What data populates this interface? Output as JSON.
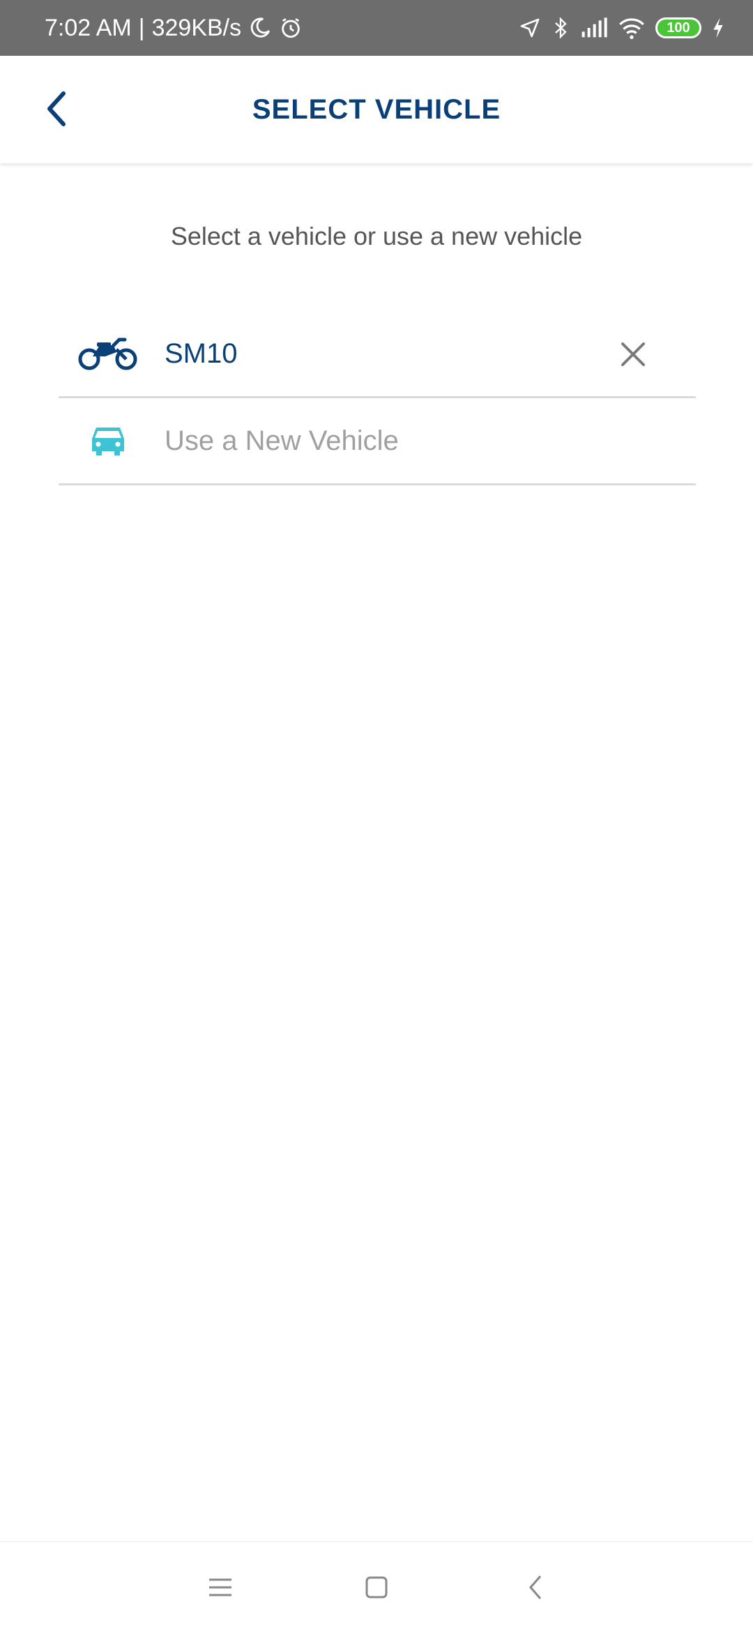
{
  "status_bar": {
    "time": "7:02 AM",
    "separator": "|",
    "network_speed": "329KB/s",
    "battery_level": "100",
    "icons": [
      "moon-icon",
      "alarm-icon",
      "location-icon",
      "bluetooth-icon",
      "signal-icon",
      "wifi-icon",
      "battery-icon",
      "charging-icon"
    ],
    "battery_color": "#4cc43a"
  },
  "header": {
    "title": "SELECT VEHICLE",
    "back_icon": "chevron-left-icon"
  },
  "main": {
    "subtitle": "Select a vehicle or use a new vehicle",
    "vehicles": [
      {
        "label": "SM10",
        "icon": "motorcycle-icon",
        "icon_color": "#0b3f77",
        "removable": true,
        "remove_icon": "close-icon"
      },
      {
        "label": "Use a New Vehicle",
        "icon": "car-icon",
        "icon_color": "#3ec3d5",
        "removable": false
      }
    ]
  },
  "nav_bar": {
    "buttons": [
      "menu-icon",
      "home-square-icon",
      "back-chevron-icon"
    ]
  },
  "colors": {
    "primary": "#0b3f77",
    "accent": "#3ec3d5",
    "status_bar_bg": "#6d6d6d"
  }
}
